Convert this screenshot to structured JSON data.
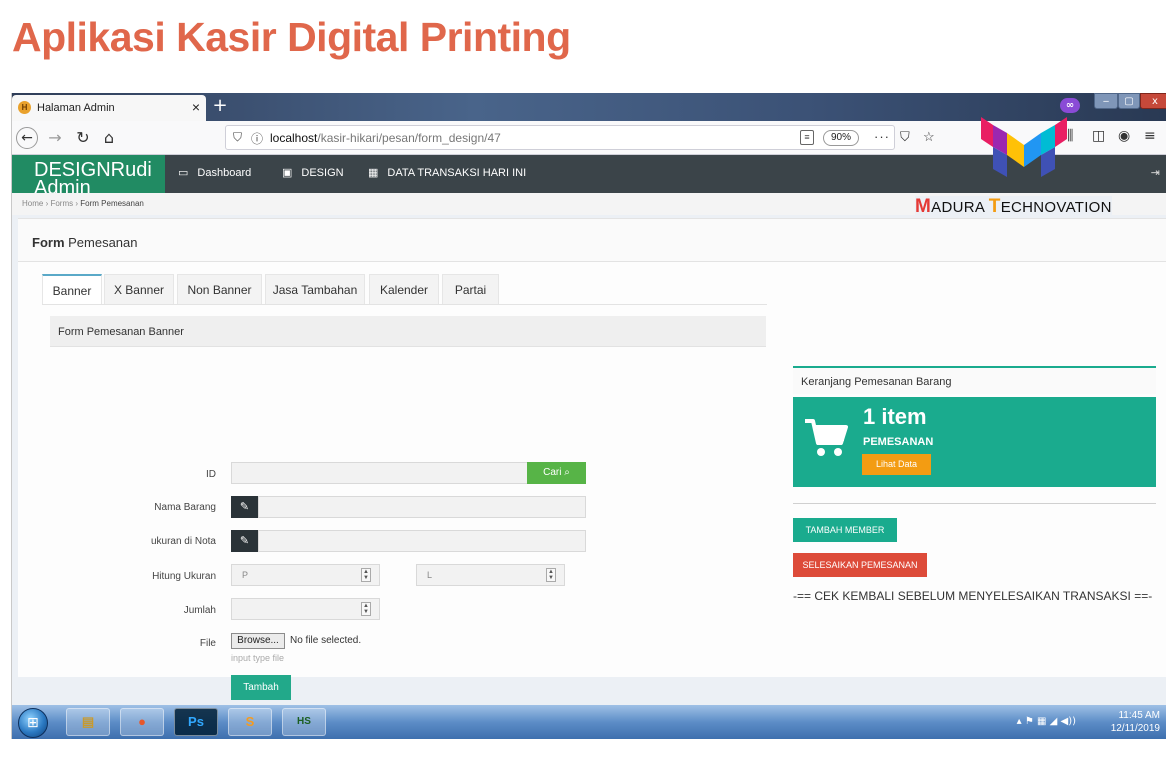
{
  "slide": {
    "title": "Aplikasi Kasir Digital Printing"
  },
  "browser": {
    "tab_title": "Halaman Admin",
    "tab_close": "×",
    "new_tab": "+",
    "url_host": "localhost",
    "url_path": "/kasir-hikari/pesan/form_design/47",
    "zoom": "90%"
  },
  "logo": {
    "text_m": "M",
    "text_adura": "ADURA ",
    "text_t": "T",
    "text_echnovation": "ECHNOVATION"
  },
  "app": {
    "brand": "DESIGNRudi Admin",
    "menu": [
      {
        "label": "Dashboard",
        "icon": "monitor-icon"
      },
      {
        "label": "DESIGN",
        "icon": "image-icon"
      },
      {
        "label": "DATA TRANSAKSI HARI INI",
        "icon": "grid-icon"
      }
    ]
  },
  "breadcrumb": {
    "home": "Home",
    "forms": "Forms",
    "current": "Form Pemesanan"
  },
  "page": {
    "title_bold": "Form",
    "title_rest": " Pemesanan"
  },
  "tabs": [
    "Banner",
    "X Banner",
    "Non Banner",
    "Jasa Tambahan",
    "Kalender",
    "Partai"
  ],
  "form": {
    "panel_title": "Form Pemesanan Banner",
    "labels": {
      "id": "ID",
      "nama_barang": "Nama Barang",
      "ukuran_nota": "ukuran di Nota",
      "hitung_ukuran": "Hitung Ukuran",
      "jumlah": "Jumlah",
      "file": "File"
    },
    "cari": "Cari",
    "p_placeholder": "P",
    "l_placeholder": "L",
    "browse": "Browse...",
    "no_file": "No file selected.",
    "file_hint": "input type file",
    "submit": "Tambah"
  },
  "cart": {
    "title": "Keranjang Pemesanan Barang",
    "count": "1 item",
    "label": "PEMESANAN",
    "view": "Lihat Data",
    "member_button": "TAMBAH MEMBER",
    "finish_button": "SELESAIKAN PEMESANAN",
    "notice": "-== CEK KEMBALI SEBELUM MENYELESAIKAN TRANSAKSI ==-"
  },
  "taskbar": {
    "apps": [
      "file-explorer",
      "firefox",
      "photoshop",
      "sublime-text",
      "hs-app"
    ],
    "ps_label": "Ps",
    "hs_label": "HS",
    "time": "11:45 AM",
    "date": "12/11/2019"
  },
  "colors": {
    "title": "#e0674b",
    "brand_green": "#218b63",
    "teal": "#1aab8e",
    "orange": "#f39c12",
    "red": "#dd4b39",
    "green": "#57b447"
  }
}
